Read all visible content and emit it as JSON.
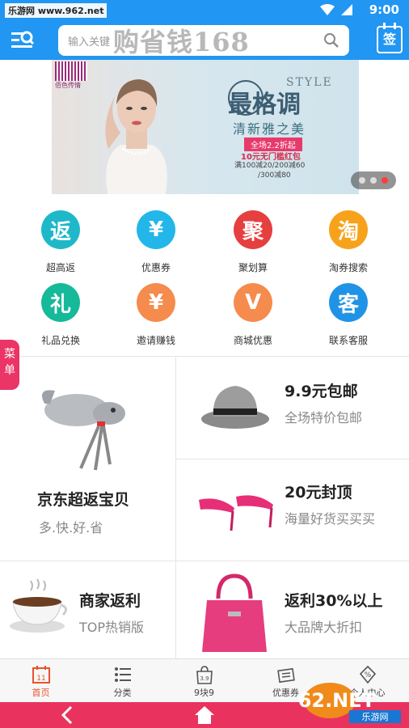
{
  "statusbar": {
    "site": "乐游网 www.962.net",
    "time": "9:00"
  },
  "header": {
    "search_placeholder": "输入关键",
    "brand_overlay": "购省钱168",
    "sign_label": "签"
  },
  "banner": {
    "logo_text": "佰色传情",
    "style_en": "STYLE",
    "style_zh": "最格调",
    "subtitle": "清新雅之美",
    "tag": "全场2.2折起",
    "line1": "10元无门槛红包",
    "line2": "满100减20/200减60",
    "line3": "/300减80",
    "active_dot": 2
  },
  "grid": [
    {
      "label": "超高返",
      "glyph": "返",
      "color": "#1fb8c9"
    },
    {
      "label": "优惠券",
      "glyph": "¥",
      "color": "#22b7e8"
    },
    {
      "label": "聚划算",
      "glyph": "聚",
      "color": "#e63f3f"
    },
    {
      "label": "淘券搜索",
      "glyph": "淘",
      "color": "#f7a21b"
    },
    {
      "label": "礼品兑换",
      "glyph": "礼",
      "color": "#16b99a"
    },
    {
      "label": "邀请赚钱",
      "glyph": "¥",
      "color": "#f58b4c"
    },
    {
      "label": "商城优惠",
      "glyph": "V",
      "color": "#f58b4c"
    },
    {
      "label": "联系客服",
      "glyph": "客",
      "color": "#2193e6"
    }
  ],
  "side_tab": "菜单",
  "promos": {
    "jd": {
      "title": "京东超返宝贝",
      "sub": "多.快.好.省"
    },
    "p99": {
      "title": "9.9元包邮",
      "sub": "全场特价包邮"
    },
    "p20": {
      "title": "20元封顶",
      "sub": "海量好货买买买"
    },
    "merchant": {
      "title": "商家返利",
      "sub": "TOP热销版"
    },
    "rebate": {
      "title": "返利30%以上",
      "sub": "大品牌大折扣"
    }
  },
  "tabbar": [
    {
      "label": "首页",
      "icon": "calendar-icon"
    },
    {
      "label": "分类",
      "icon": "list-icon"
    },
    {
      "label": "9块9",
      "icon": "bag-icon"
    },
    {
      "label": "优惠券",
      "icon": "coupon-icon"
    },
    {
      "label": "个人中心",
      "icon": "user-icon"
    }
  ],
  "tab_calendar_num": "11",
  "tab_bag_num": "3.9",
  "watermark": {
    "big": "962.NET",
    "small": "乐游网"
  }
}
